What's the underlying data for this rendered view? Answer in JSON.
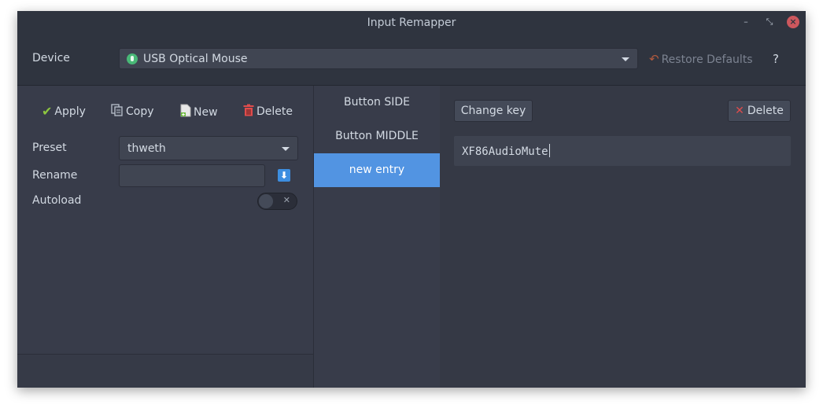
{
  "window": {
    "title": "Input Remapper",
    "minimize_glyph": "–",
    "maximize_glyph": "⤡",
    "close_glyph": "×"
  },
  "device": {
    "label": "Device",
    "selected": "USB Optical Mouse",
    "device_icon": "mouse-device-icon",
    "restore_label": "Restore Defaults",
    "help_label": "?"
  },
  "toolbar": {
    "apply_label": "Apply",
    "copy_label": "Copy",
    "new_label": "New",
    "delete_label": "Delete"
  },
  "preset": {
    "label": "Preset",
    "selected": "thweth",
    "rename_label": "Rename",
    "rename_value": "",
    "autoload_label": "Autoload",
    "autoload_on": false
  },
  "keys": {
    "items": [
      {
        "label": "Button SIDE",
        "selected": false
      },
      {
        "label": "Button MIDDLE",
        "selected": false
      },
      {
        "label": "new entry",
        "selected": true
      }
    ]
  },
  "mapping": {
    "change_key_label": "Change key",
    "delete_label": "Delete",
    "output": "XF86AudioMute"
  },
  "colors": {
    "accent": "#5294e2",
    "apply_check": "#8dc63f",
    "delete_red": "#e04c4c"
  }
}
